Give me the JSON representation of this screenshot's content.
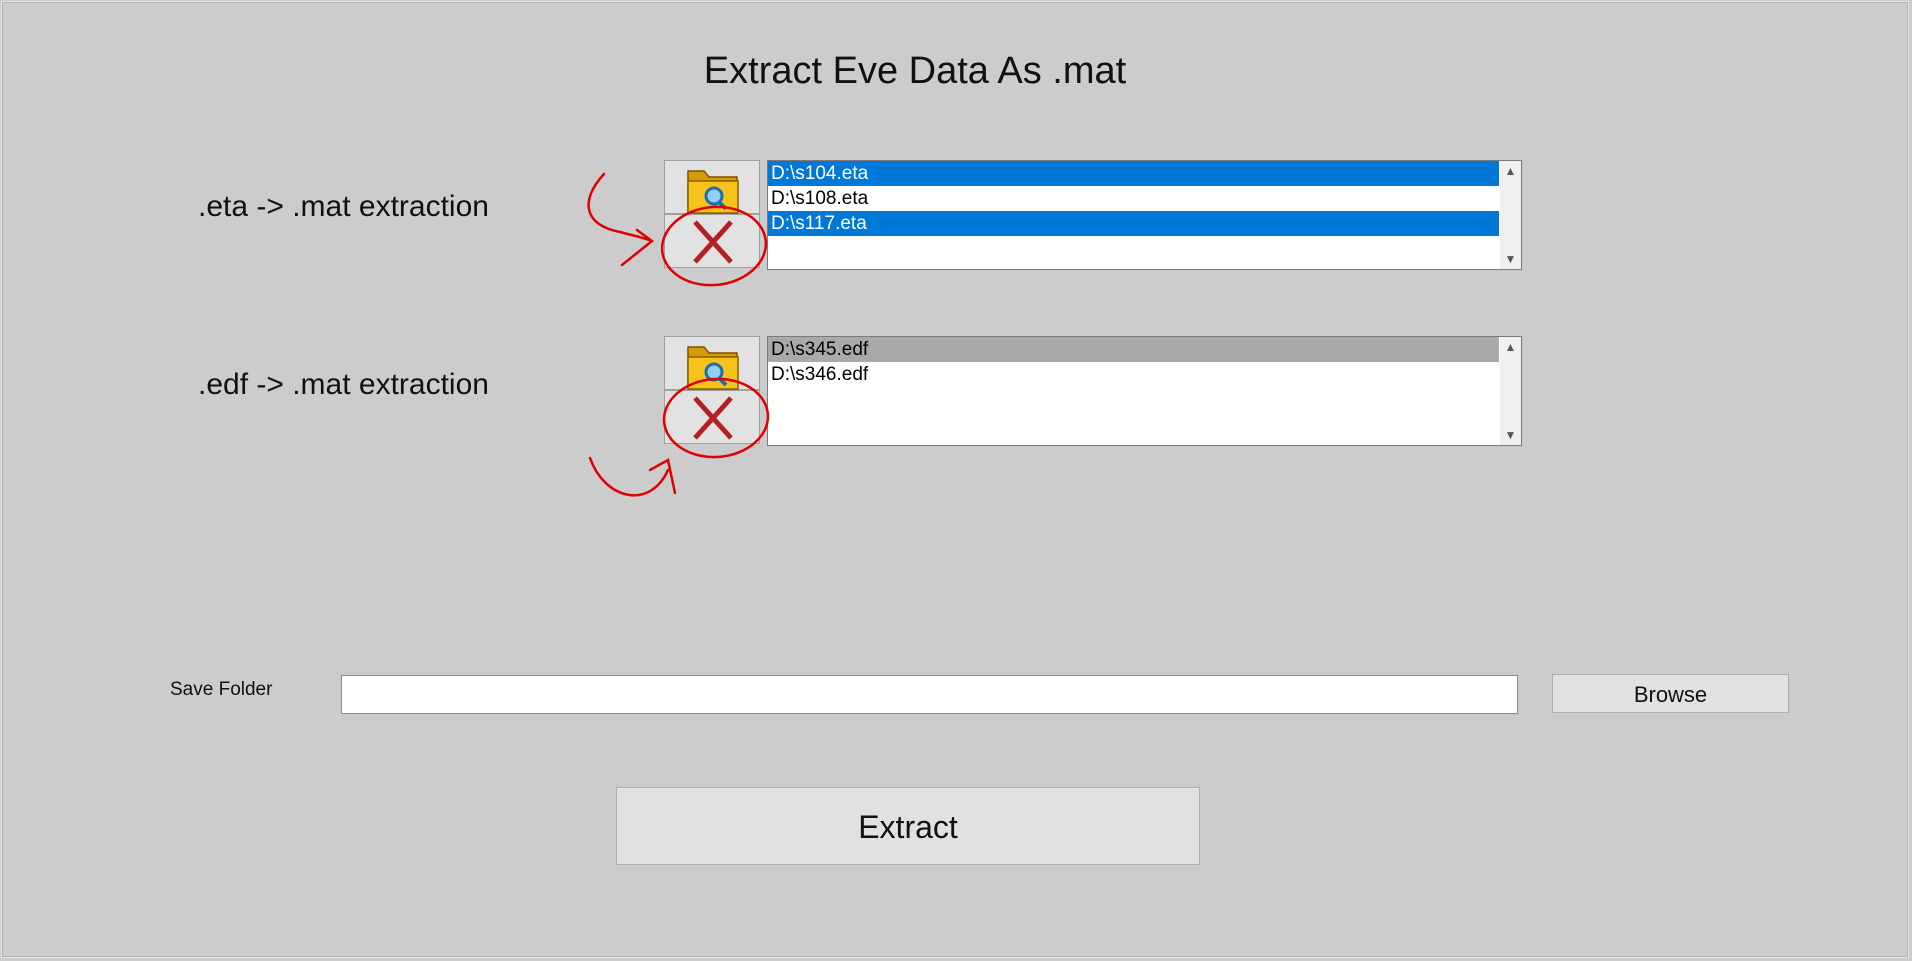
{
  "title": "Extract Eve Data As .mat",
  "eta_section": {
    "label": ".eta -> .mat extraction",
    "files": [
      {
        "name": "D:\\s104.eta",
        "state": "selected"
      },
      {
        "name": "D:\\s108.eta",
        "state": "normal"
      },
      {
        "name": "D:\\s117.eta",
        "state": "selected"
      }
    ],
    "browse_icon": "folder-search-icon",
    "remove_icon": "red-x-icon"
  },
  "edf_section": {
    "label": ".edf -> .mat extraction",
    "files": [
      {
        "name": "D:\\s345.edf",
        "state": "inactive-selected"
      },
      {
        "name": "D:\\s346.edf",
        "state": "normal"
      }
    ],
    "browse_icon": "folder-search-icon",
    "remove_icon": "red-x-icon"
  },
  "save": {
    "label": "Save Folder",
    "value": "",
    "browse_label": "Browse"
  },
  "extract_label": "Extract",
  "colors": {
    "background": "#cccccc",
    "selection": "#0078d7",
    "inactive_selection": "#a9a9a9",
    "annotation": "#e00000"
  }
}
